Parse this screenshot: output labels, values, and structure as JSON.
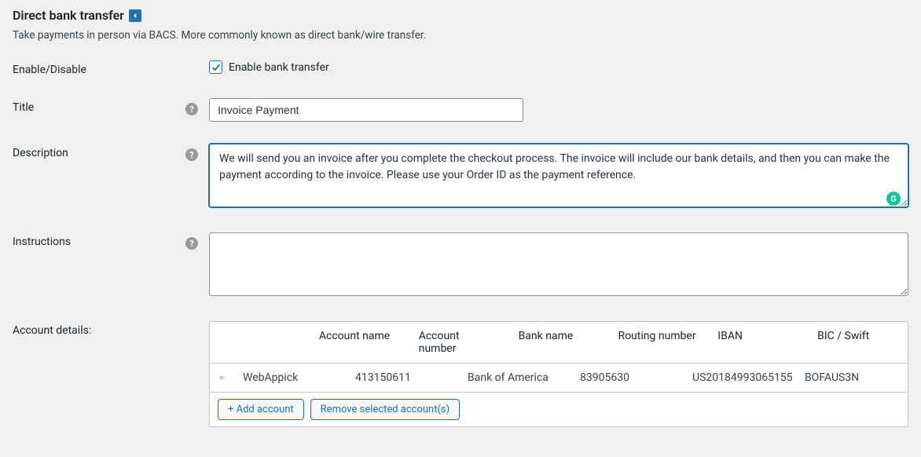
{
  "header": {
    "title": "Direct bank transfer",
    "description": "Take payments in person via BACS. More commonly known as direct bank/wire transfer."
  },
  "form": {
    "enable": {
      "label": "Enable/Disable",
      "checkbox_label": "Enable bank transfer",
      "checked": true
    },
    "title": {
      "label": "Title",
      "value": "Invoice Payment"
    },
    "description": {
      "label": "Description",
      "value": "We will send you an invoice after you complete the checkout process. The invoice will include our bank details, and then you can make the payment according to the invoice. Please use your Order ID as the payment reference."
    },
    "instructions": {
      "label": "Instructions",
      "value": ""
    },
    "account_details": {
      "label": "Account details:",
      "headers": {
        "account_name": "Account name",
        "account_number": "Account number",
        "bank_name": "Bank name",
        "routing_number": "Routing number",
        "iban": "IBAN",
        "bic_swift": "BIC / Swift"
      },
      "rows": [
        {
          "account_name": "WebAppick",
          "account_number": "413150611",
          "bank_name": "Bank of America",
          "routing_number": "83905630",
          "iban": "US20184993065155",
          "bic_swift": "BOFAUS3N"
        }
      ],
      "buttons": {
        "add": "+ Add account",
        "remove": "Remove selected account(s)"
      }
    }
  }
}
